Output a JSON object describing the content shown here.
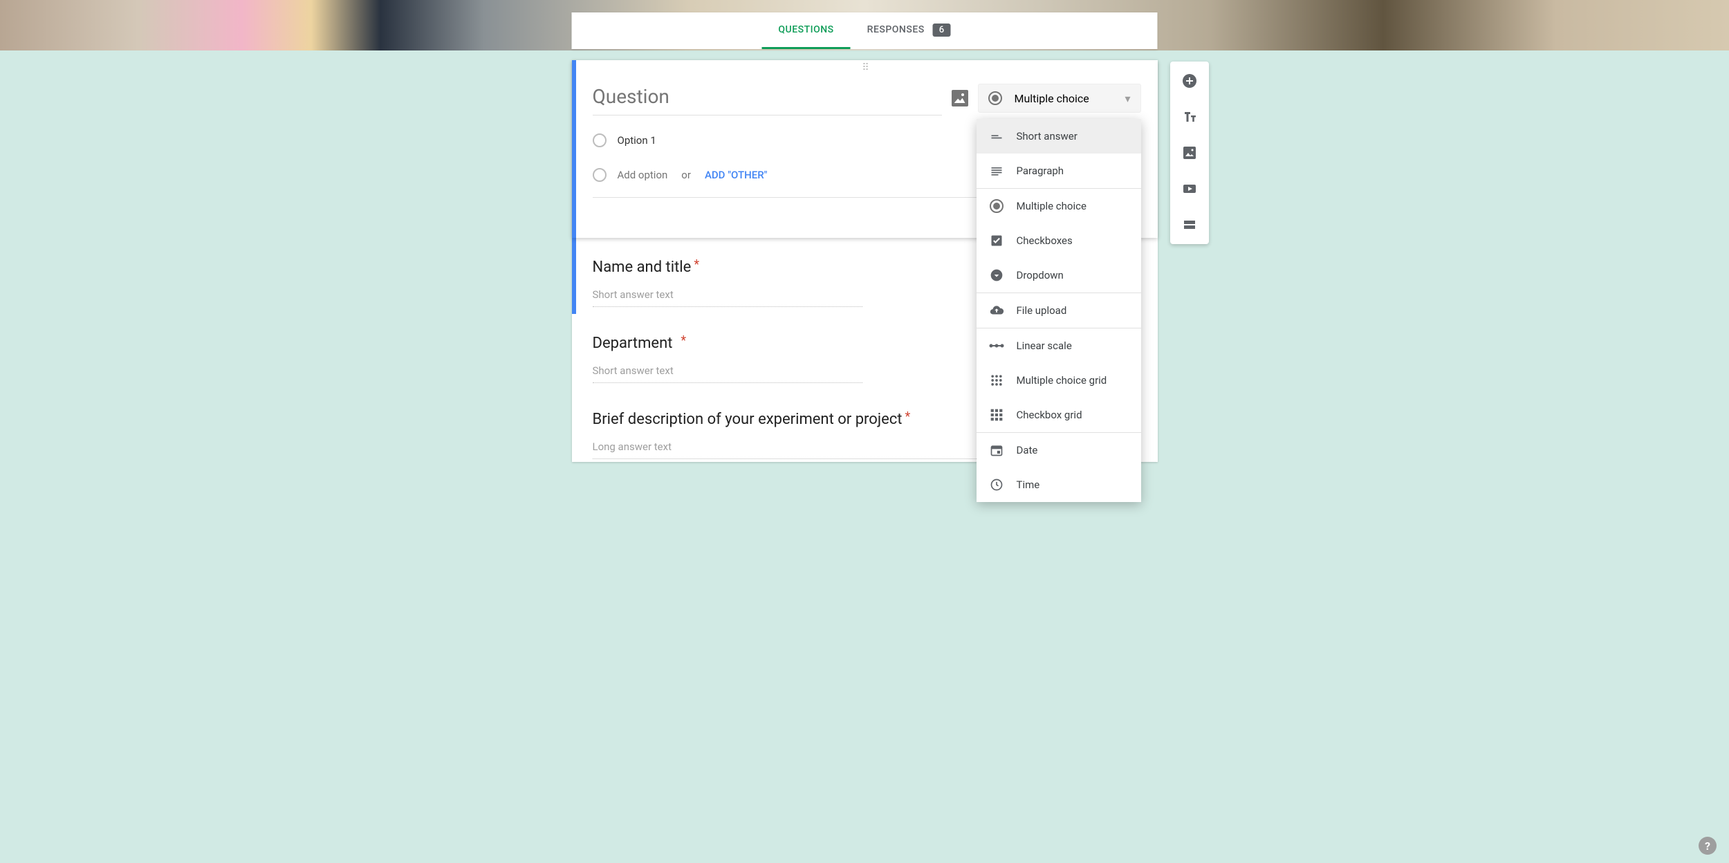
{
  "tabs": {
    "questions": "QUESTIONS",
    "responses": "RESPONSES",
    "responses_count": "6"
  },
  "editor": {
    "question_placeholder": "Question",
    "selected_type": "Multiple choice",
    "option1": "Option 1",
    "add_option": "Add option",
    "or": "or",
    "add_other": "ADD \"OTHER\""
  },
  "type_menu": {
    "short_answer": "Short answer",
    "paragraph": "Paragraph",
    "multiple_choice": "Multiple choice",
    "checkboxes": "Checkboxes",
    "dropdown": "Dropdown",
    "file_upload": "File upload",
    "linear_scale": "Linear scale",
    "mc_grid": "Multiple choice grid",
    "cb_grid": "Checkbox grid",
    "date": "Date",
    "time": "Time"
  },
  "questions": {
    "q1_title": "Name and title",
    "q1_hint": "Short answer text",
    "q2_title": "Department",
    "q2_hint": "Short answer text",
    "q3_title": "Brief description of your experiment or project",
    "q3_hint": "Long answer text"
  }
}
